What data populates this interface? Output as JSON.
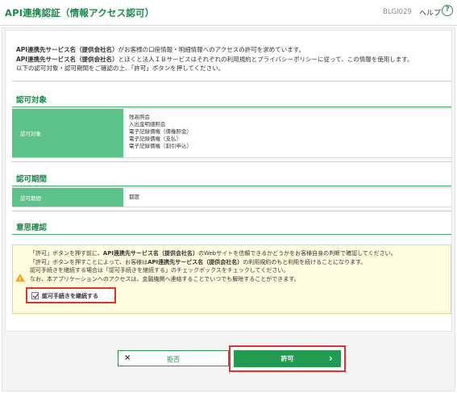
{
  "header": {
    "title": "API連携認証（情報アクセス認可）",
    "screen_id": "BLGI029",
    "help_label": "ヘルプ",
    "help_icon": "?"
  },
  "intro": {
    "line1_bold": "API連携先サービス名（提供会社名）",
    "line1_rest": "がお客様の口座情報・明細情報へのアクセスの許可を求めています。",
    "line2_bold": "API連携先サービス名（提供会社名）",
    "line2_rest": "とほくと法人ＩＢサービスはそれぞれの利用規約とプライバシーポリシーに従って、この情報を使用します。",
    "line3": "以下の認可対象・認可期間をご確認の上、「許可」ボタンを押してください。"
  },
  "scope_section": {
    "title": "認可対象",
    "label": "認可対象",
    "items": [
      "残高照会",
      "入出金明細照会",
      "電子記録債権（債権照会）",
      "電子記録債権（支払）",
      "電子記録債権（割引申込）"
    ]
  },
  "period_section": {
    "title": "認可期間",
    "label": "認可期間",
    "value": "都度"
  },
  "confirm_section": {
    "title": "意思確認",
    "notice_line1_a": "「許可」ボタンを押す前に、",
    "notice_line1_bold": "API連携先サービス名（提供会社名）",
    "notice_line1_b": "のWebサイトを信頼できるかどうかをお客様自身の判断で確認してください。",
    "notice_line2_a": "「許可」ボタンを押すことによって、お客様は",
    "notice_line2_bold": "API連携先サービス名（提供会社名）",
    "notice_line2_b": "の利用規約のもと利用を続けることになります。",
    "notice_line3": "認可手続きを継続する場合は「認可手続きを継続する」のチェックボックスをチェックしてください。",
    "notice_line4": "なお、本アプリケーションへのアクセスは、金融機関へ連絡することでいつでも解除することができます。",
    "warning_mark": "!",
    "checkbox_label": "認可手続きを継続する",
    "checkbox_checked": true
  },
  "buttons": {
    "reject_icon": "×",
    "reject_label": "拒否",
    "approve_label": "許可",
    "approve_icon": "›"
  },
  "colors": {
    "brand_green": "#1a8a4a",
    "label_green": "#5dc18a",
    "approve_green": "#239a52",
    "highlight_red": "#e0332e",
    "notice_bg": "#fffce0",
    "warning_orange": "#f0a62c"
  }
}
